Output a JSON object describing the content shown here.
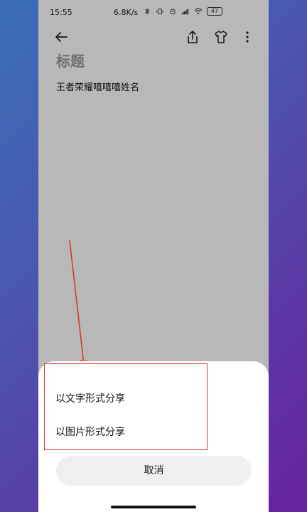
{
  "status_bar": {
    "time": "15:55",
    "network_speed": "6.8K/s",
    "battery": "47",
    "icons": [
      "bluetooth-icon",
      "vibrate-icon",
      "alarm-icon",
      "signal-icon",
      "wifi-icon",
      "battery-icon"
    ]
  },
  "toolbar": {
    "icons": [
      "back-arrow-icon",
      "share-icon",
      "shirt-icon",
      "more-vertical-icon"
    ]
  },
  "note": {
    "title": "标题",
    "content": "王者荣耀嘻嘻嘻姓名"
  },
  "share_sheet": {
    "option_text": "以文字形式分享",
    "option_image": "以图片形式分享",
    "cancel_label": "取消"
  },
  "colors": {
    "annotation_red": "#d63a2a",
    "sheet_bg": "#ffffff",
    "cancel_bg": "#efefef"
  }
}
